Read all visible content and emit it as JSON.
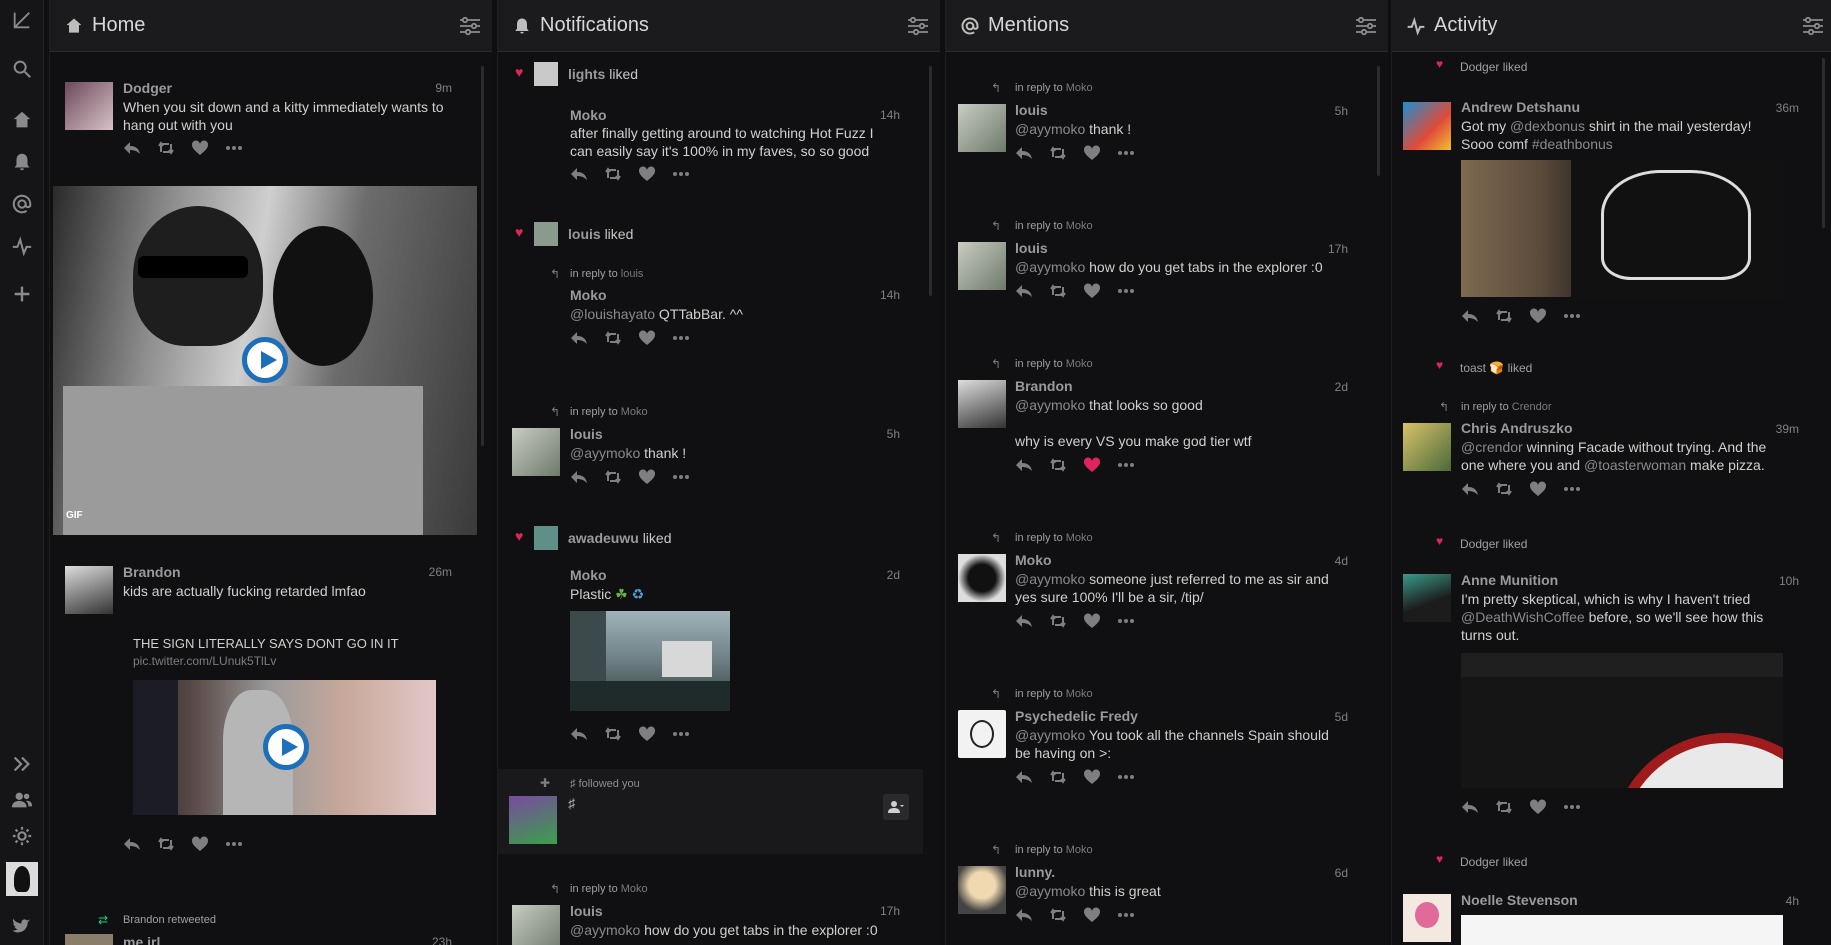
{
  "nav": {
    "compose": "compose-icon",
    "search": "search-icon",
    "home": "home-icon",
    "notifications": "bell-icon",
    "mentions": "at-icon",
    "activity": "activity-icon",
    "add_column": "plus-icon",
    "expand": "chevrons-right-icon",
    "accounts": "accounts-icon",
    "settings": "gear-icon",
    "twitter": "twitter-bird-icon"
  },
  "colors": {
    "accent_blue": "#1c6fb8",
    "like_red": "#e0245e",
    "retweet_green": "#19cf86"
  },
  "columns": {
    "home": {
      "title": "Home",
      "tweets": [
        {
          "name": "Dodger",
          "time": "9m",
          "text": "When you sit down and a kitty immediately wants to hang out with you",
          "media_badge": "GIF"
        },
        {
          "name": "Brandon",
          "time": "26m",
          "text": "kids are actually fucking retarded lmfao",
          "quote": "THE SIGN LITERALLY SAYS DONT GO IN IT",
          "link": "pic.twitter.com/LUnuk5TlLv"
        },
        {
          "retweet_note": "Brandon retweeted",
          "name": "me irl",
          "time": "23h"
        }
      ]
    },
    "notifications": {
      "title": "Notifications",
      "items": [
        {
          "liker": "lights",
          "liked_word": "liked",
          "name": "Moko",
          "time": "14h",
          "text": "after finally getting around to watching Hot Fuzz I can easily say it's 100% in my faves, so so good"
        },
        {
          "liker": "louis",
          "liked_word": "liked",
          "reply_prefix": "in reply to",
          "reply_to": "louis",
          "name": "Moko",
          "time": "14h",
          "mention": "@louishayato",
          "text": " QTTabBar. ^^"
        },
        {
          "reply_prefix": "in reply to",
          "reply_to": "Moko",
          "name": "louis",
          "time": "5h",
          "mention": "@ayymoko",
          "text": " thank !"
        },
        {
          "liker": "awadeuwu",
          "liked_word": "liked",
          "name": "Moko",
          "time": "2d",
          "text": "Plastic"
        },
        {
          "follower": "♯",
          "follow_text": "followed you",
          "body": "♯"
        },
        {
          "reply_prefix": "in reply to",
          "reply_to": "Moko",
          "name": "louis",
          "time": "17h",
          "mention": "@ayymoko",
          "text": " how do you get tabs in the explorer :0"
        }
      ]
    },
    "mentions": {
      "title": "Mentions",
      "items": [
        {
          "reply_prefix": "in reply to",
          "reply_to": "Moko",
          "name": "louis",
          "time": "5h",
          "mention": "@ayymoko",
          "text": " thank !"
        },
        {
          "reply_prefix": "in reply to",
          "reply_to": "Moko",
          "name": "louis",
          "time": "17h",
          "mention": "@ayymoko",
          "text": " how do you get tabs in the explorer :0"
        },
        {
          "reply_prefix": "in reply to",
          "reply_to": "Moko",
          "name": "Brandon",
          "time": "2d",
          "mention": "@ayymoko",
          "text": " that looks so good",
          "text2": "why is every VS you make god tier wtf"
        },
        {
          "reply_prefix": "in reply to",
          "reply_to": "Moko",
          "name": "Moko",
          "time": "4d",
          "mention": "@ayymoko",
          "text": " someone just referred to me as sir and yes sure 100% I'll be a sir, /tip/"
        },
        {
          "reply_prefix": "in reply to",
          "reply_to": "Moko",
          "name": "Psychedelic Fredy",
          "time": "5d",
          "mention": "@ayymoko",
          "text": " You took all the channels Spain should be having on >:"
        },
        {
          "reply_prefix": "in reply to",
          "reply_to": "Moko",
          "name": "lunny.",
          "time": "6d",
          "mention": "@ayymoko",
          "text": " this is great"
        }
      ]
    },
    "activity": {
      "title": "Activity",
      "items": [
        {
          "liker": "Dodger liked",
          "name": "Andrew Detshanu",
          "time": "36m",
          "t1": "Got my ",
          "m1": "@dexbonus",
          "t2": " shirt in the mail yesterday! Sooo comf ",
          "m2": "#deathbonus"
        },
        {
          "liker": "toast 🍞 liked",
          "reply_prefix": "in reply to",
          "reply_to": "Crendor",
          "name": "Chris Andruszko",
          "time": "39m",
          "m1": "@crendor",
          "t1": " winning Facade without trying. And the one where you and ",
          "m2": "@toasterwoman",
          "t2": " make pizza."
        },
        {
          "liker": "Dodger liked",
          "name": "Anne Munition",
          "time": "10h",
          "t1": "I'm pretty skeptical, which is why I haven't tried ",
          "m1": "@DeathWishCoffee",
          "t2": " before, so we'll see how this turns out."
        },
        {
          "liker": "Dodger liked",
          "name": "Noelle Stevenson",
          "time": "4h"
        }
      ]
    }
  }
}
